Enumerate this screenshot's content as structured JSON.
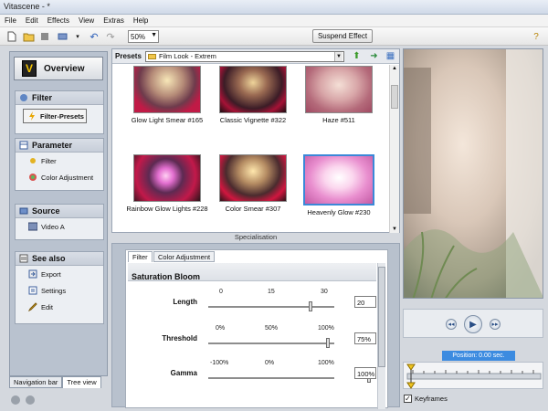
{
  "window": {
    "title": "Vitascene - *"
  },
  "menu": [
    "File",
    "Edit",
    "Effects",
    "View",
    "Extras",
    "Help"
  ],
  "toolbar": {
    "zoom": "50%",
    "suspend_label": "Suspend Effect"
  },
  "nav": {
    "overview_label": "Overview",
    "filter_head": "Filter",
    "filter_presets": "Filter-Presets",
    "parameter_head": "Parameter",
    "parameter_items": [
      "Filter",
      "Color Adjustment"
    ],
    "source_head": "Source",
    "source_items": [
      "Video A"
    ],
    "see_also_head": "See also",
    "see_also_items": [
      "Export",
      "Settings",
      "Edit"
    ],
    "tabs": [
      "Navigation bar",
      "Tree view"
    ]
  },
  "presets": {
    "label": "Presets",
    "selected_folder": "Film Look - Extrem",
    "items": [
      "Glow Light Smear #165",
      "Classic Vignette #322",
      "Haze #511",
      "Rainbow Glow Lights #228",
      "Color Smear #307",
      "Heavenly Glow #230"
    ],
    "selected_index": 5,
    "specialisation_label": "Specialisation"
  },
  "params": {
    "tabs": [
      "Filter",
      "Color Adjustment"
    ],
    "title": "Saturation Bloom",
    "rows": [
      {
        "name": "Length",
        "ticks": [
          "0",
          "15",
          "30"
        ],
        "value": "20"
      },
      {
        "name": "Threshold",
        "ticks": [
          "0%",
          "50%",
          "100%"
        ],
        "value": "75%"
      },
      {
        "name": "Gamma",
        "ticks": [
          "-100%",
          "0%",
          "100%"
        ],
        "value": "100%"
      }
    ]
  },
  "player": {
    "position": "Position: 0.00 sec.",
    "keyframes_label": "Keyframes"
  }
}
